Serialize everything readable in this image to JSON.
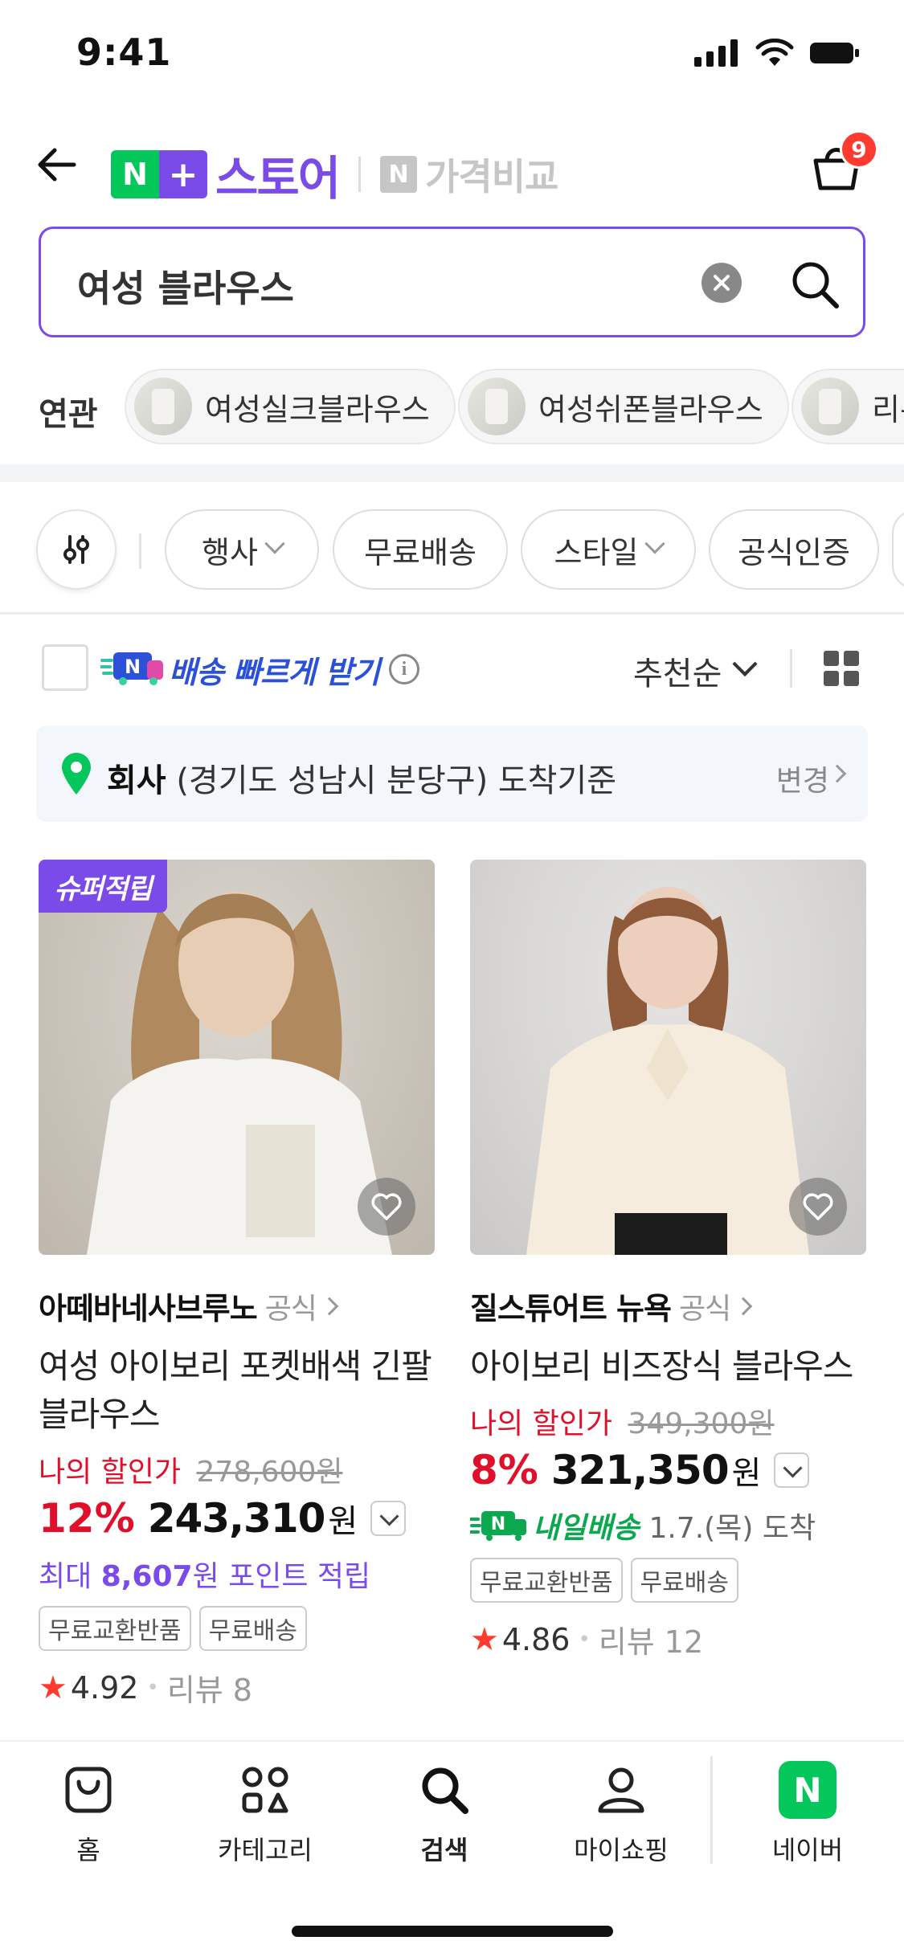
{
  "status_bar": {
    "time": "9:41"
  },
  "header": {
    "logo_n": "N",
    "logo_plus": "+",
    "store_label": "스토어",
    "compare_n": "N",
    "compare_label": "가격비교",
    "cart_count": "9"
  },
  "search": {
    "query": "여성 블라우스"
  },
  "related": {
    "label": "연관",
    "items": [
      "여성실크블라우스",
      "여성쉬폰블라우스",
      "리본"
    ]
  },
  "filters": {
    "chips": [
      {
        "label": "행사",
        "has_dropdown": true
      },
      {
        "label": "무료배송",
        "has_dropdown": false
      },
      {
        "label": "스타일",
        "has_dropdown": true
      },
      {
        "label": "공식인증",
        "has_dropdown": false
      }
    ]
  },
  "options": {
    "fast_delivery_label": "배송 빠르게 받기",
    "info_glyph": "i",
    "sort_label": "추천순"
  },
  "location": {
    "name": "회사",
    "address": "(경기도 성남시 분당구) 도착기준",
    "change_label": "변경"
  },
  "products": [
    {
      "badge": "슈퍼적립",
      "brand": "아떼바네사브루노",
      "official_label": "공식",
      "title": "여성 아이보리 포켓배색 긴팔블라우스",
      "my_discount_label": "나의 할인가",
      "original_price": "278,600원",
      "discount_pct": "12%",
      "price": "243,310",
      "currency": "원",
      "point_prefix": "최대 ",
      "point_amount": "8,607",
      "point_suffix": "원 포인트 적립",
      "tags": [
        "무료교환반품",
        "무료배송"
      ],
      "rating": "4.92",
      "review": "리뷰 8"
    },
    {
      "brand": "질스튜어트 뉴욕",
      "official_label": "공식",
      "title": "아이보리 비즈장식 블라우스",
      "my_discount_label": "나의 할인가",
      "original_price": "349,300원",
      "discount_pct": "8%",
      "price": "321,350",
      "currency": "원",
      "delivery_label": "내일배송",
      "delivery_date": "1.7.(목) 도착",
      "tags": [
        "무료교환반품",
        "무료배송"
      ],
      "rating": "4.86",
      "review": "리뷰 12"
    }
  ],
  "bottom_nav": {
    "items": [
      {
        "label": "홈",
        "icon": "bag-icon"
      },
      {
        "label": "카테고리",
        "icon": "category-icon"
      },
      {
        "label": "검색",
        "icon": "search-icon",
        "active": true
      },
      {
        "label": "마이쇼핑",
        "icon": "person-icon"
      },
      {
        "label": "네이버",
        "icon": "naver-icon"
      }
    ],
    "naver_glyph": "N"
  },
  "colors": {
    "brand_purple": "#7b4bea",
    "naver_green": "#03c75a",
    "discount_red": "#e0102a",
    "fast_blue": "#2b51d8"
  }
}
